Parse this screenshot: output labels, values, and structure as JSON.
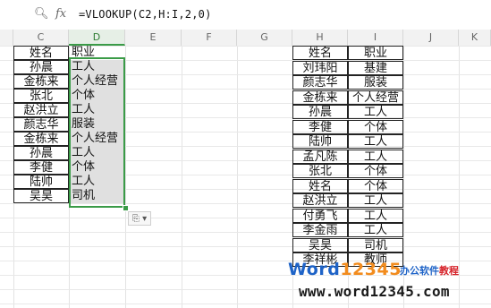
{
  "formula_bar": {
    "zoom_icon": "magnify-icon",
    "fx_label": "fx",
    "formula": "=VLOOKUP(C2,H:I,2,0)"
  },
  "columns": [
    "C",
    "D",
    "E",
    "F",
    "G",
    "H",
    "I",
    "J",
    "K"
  ],
  "left_table": {
    "names": [
      "姓名",
      "孙晨",
      "金栋来",
      "张北",
      "赵洪立",
      "颜志华",
      "金栋来",
      "孙晨",
      "李健",
      "陆帅",
      "吴昊"
    ],
    "jobs": [
      "职业",
      "工人",
      "个人经营",
      "个体",
      "工人",
      "服装",
      "个人经营",
      "工人",
      "个体",
      "工人",
      "司机"
    ]
  },
  "right_table": {
    "names": [
      "姓名",
      "刘玮阳",
      "颜志华",
      "金栋来",
      "孙晨",
      "李健",
      "陆帅",
      "孟凡陈",
      "张北",
      "姓名",
      "赵洪立",
      "付勇飞",
      "李金雨",
      "吴昊",
      "李祥彬"
    ],
    "jobs": [
      "职业",
      "基建",
      "服装",
      "个人经营",
      "工人",
      "个体",
      "工人",
      "工人",
      "个体",
      "个体",
      "工人",
      "工人",
      "工人",
      "司机",
      "教师"
    ]
  },
  "paste_options_label": "⎘ ▾",
  "watermark": {
    "logo_word": "Word",
    "logo_num": "12345",
    "subtitle_a": "办公软件",
    "subtitle_b": "教程",
    "url": "www.word12345.com"
  },
  "colors": {
    "selection": "#3a9b47",
    "shade": "#e0e0e0",
    "brand_blue": "#1e63c7",
    "brand_orange": "#f28c1e"
  }
}
